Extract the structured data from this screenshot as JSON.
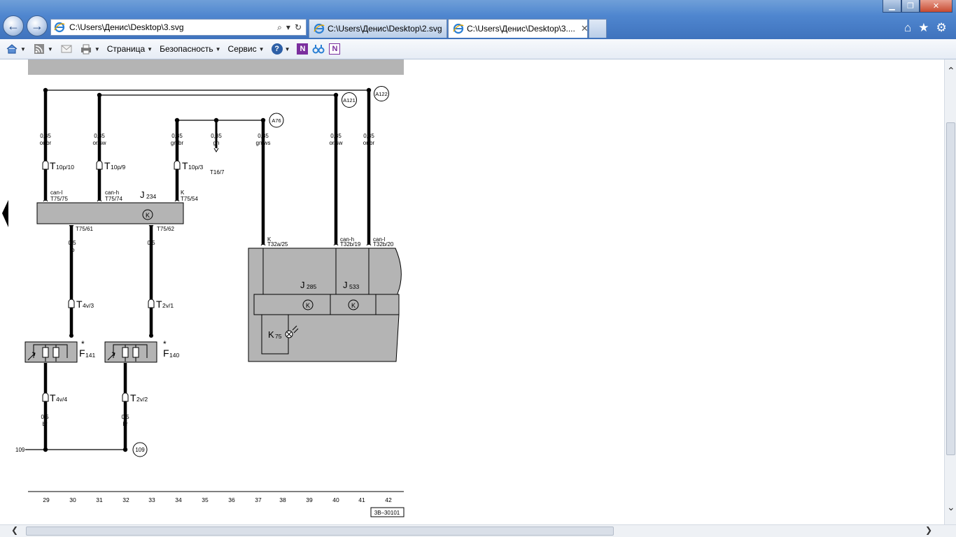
{
  "browser": {
    "address_text": "C:\\Users\\Денис\\Desktop\\3.svg",
    "tabs": [
      {
        "label": "C:\\Users\\Денис\\Desktop\\2.svg"
      },
      {
        "label": "C:\\Users\\Денис\\Desktop\\3...."
      }
    ],
    "tab_close": "✕",
    "nav_back": "←",
    "nav_forward": "→",
    "search_glyph": "⌕",
    "refresh_glyph": "↻",
    "window_minimize": "▁",
    "window_maximize": "❐",
    "window_close": "✕",
    "home_glyph": "⌂",
    "favorites_glyph": "★",
    "tools_glyph": "⚙"
  },
  "command_bar": {
    "page_label": "Страница",
    "safety_label": "Безопасность",
    "service_label": "Сервис",
    "help_glyph": "?",
    "onenote_glyph": "N"
  },
  "diagram": {
    "wire_specs": [
      {
        "size": "0,35",
        "color": "or/br"
      },
      {
        "size": "0,35",
        "color": "or/sw"
      },
      {
        "size": "0,35",
        "color": "gn/br"
      },
      {
        "size": "0,35",
        "color": "gn"
      },
      {
        "size": "0,35",
        "color": "gn/ws"
      },
      {
        "size": "0,35",
        "color": "or/sw"
      },
      {
        "size": "0,35",
        "color": "or/br"
      },
      {
        "size": "0,5",
        "color": "ro"
      },
      {
        "size": "0,5",
        "color": "li"
      },
      {
        "size": "0,5",
        "color": "br"
      },
      {
        "size": "0,5",
        "color": "br"
      }
    ],
    "connector_t": "T",
    "connectors": [
      "10p/10",
      "10p/9",
      "10p/3",
      "4v/3",
      "2v/1",
      "4v/4",
      "2v/2"
    ],
    "t16_label": "T16/7",
    "pins": [
      "can-l",
      "T75/75",
      "can-h",
      "T75/74",
      "K",
      "T75/54",
      "T75/61",
      "T75/62",
      "K",
      "T32a/25",
      "can-h",
      "T32b/19",
      "can-l",
      "T32b/20"
    ],
    "j234": {
      "letter": "J",
      "sub": "234"
    },
    "j285": {
      "letter": "J",
      "sub": "285"
    },
    "j533": {
      "letter": "J",
      "sub": "533"
    },
    "k75": {
      "letter": "K",
      "sub": "75"
    },
    "f141": {
      "letter": "F",
      "sub": "141",
      "star": "*"
    },
    "f140": {
      "letter": "F",
      "sub": "140",
      "star": "*"
    },
    "k_symbol": "K",
    "circled_refs": [
      "A121",
      "A122",
      "A76",
      "109"
    ],
    "ground_label": "109",
    "column_numbers": [
      "29",
      "30",
      "31",
      "32",
      "33",
      "34",
      "35",
      "36",
      "37",
      "38",
      "39",
      "40",
      "41",
      "42"
    ],
    "diagram_id": "3B–30101"
  },
  "scroll": {
    "up": "⌃",
    "down": "⌄",
    "left": "❮",
    "right": "❯"
  }
}
